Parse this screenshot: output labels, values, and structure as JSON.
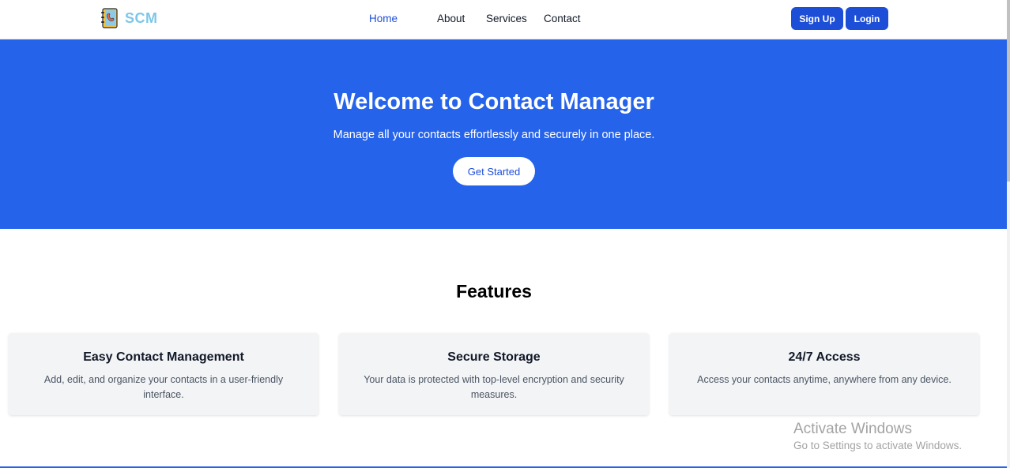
{
  "brand": {
    "name": "SCM",
    "logo_icon": "address-book-icon",
    "color": "#7cc7e8"
  },
  "nav": {
    "links": [
      {
        "label": "Home",
        "active": true
      },
      {
        "label": "About",
        "active": false
      },
      {
        "label": "Services",
        "active": false
      },
      {
        "label": "Contact",
        "active": false
      }
    ],
    "signup_label": "Sign Up",
    "login_label": "Login"
  },
  "hero": {
    "title": "Welcome to Contact Manager",
    "subtitle": "Manage all your contacts effortlessly and securely in one place.",
    "cta_label": "Get Started",
    "background": "#2563eb"
  },
  "features": {
    "title": "Features",
    "cards": [
      {
        "title": "Easy Contact Management",
        "description": "Add, edit, and organize your contacts in a user-friendly interface."
      },
      {
        "title": "Secure Storage",
        "description": "Your data is protected with top-level encryption and security measures."
      },
      {
        "title": "24/7 Access",
        "description": "Access your contacts anytime, anywhere from any device."
      }
    ]
  },
  "watermark": {
    "title": "Activate Windows",
    "subtitle": "Go to Settings to activate Windows."
  },
  "colors": {
    "accent": "#1d4ed8",
    "hero_bg": "#2563eb",
    "card_bg": "#f3f4f6"
  }
}
